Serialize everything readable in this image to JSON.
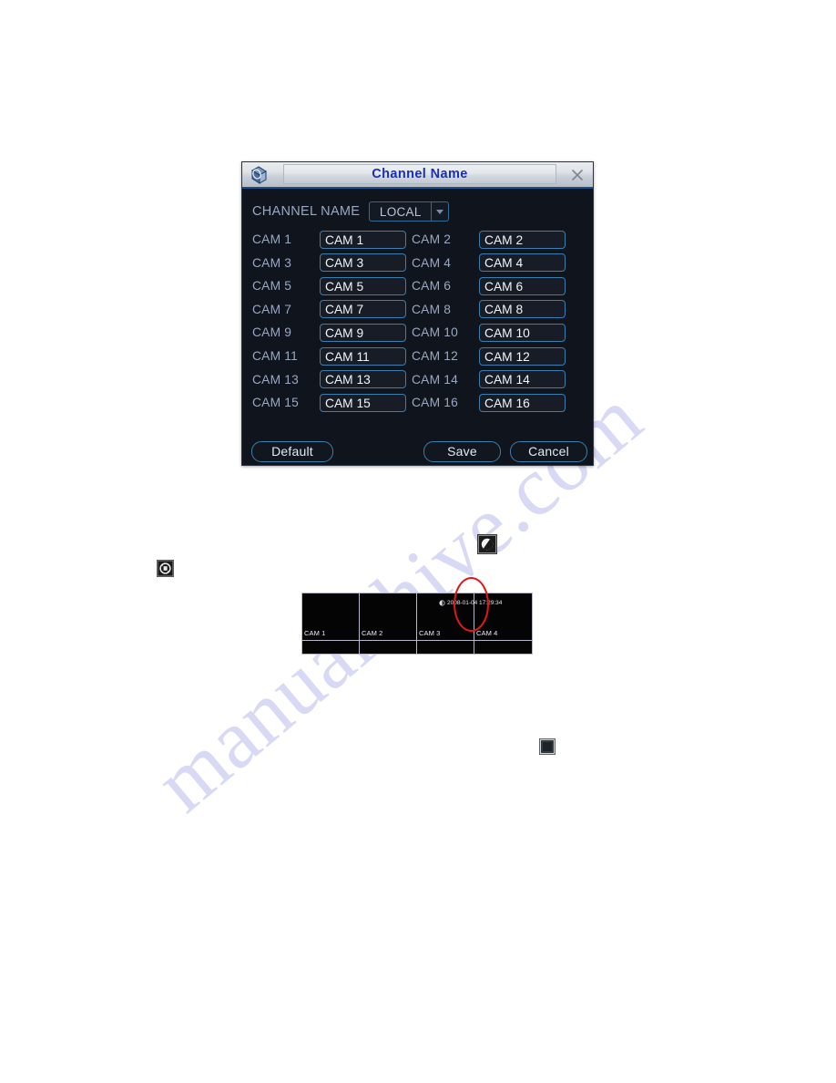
{
  "page": {
    "background_color": "#ffffff",
    "watermark": {
      "text": "manualshive.com",
      "color": "#d8d9f4"
    }
  },
  "dialog": {
    "title": "Channel Name",
    "title_color": "#1c2fae",
    "logo_icon": "cube-logo-icon",
    "close_icon": "close-icon",
    "background_color": "#10141c",
    "accent_color": "#3a7fae",
    "source": {
      "label": "CHANNEL NAME",
      "selected": "LOCAL",
      "options": [
        "LOCAL"
      ],
      "arrow_icon": "chevron-down-icon"
    },
    "channels": [
      {
        "label": "CAM 1",
        "value": "CAM 1"
      },
      {
        "label": "CAM 2",
        "value": "CAM 2"
      },
      {
        "label": "CAM 3",
        "value": "CAM 3"
      },
      {
        "label": "CAM 4",
        "value": "CAM 4"
      },
      {
        "label": "CAM 5",
        "value": "CAM 5"
      },
      {
        "label": "CAM 6",
        "value": "CAM 6"
      },
      {
        "label": "CAM 7",
        "value": "CAM 7"
      },
      {
        "label": "CAM 8",
        "value": "CAM 8"
      },
      {
        "label": "CAM 9",
        "value": "CAM 9"
      },
      {
        "label": "CAM 10",
        "value": "CAM 10"
      },
      {
        "label": "CAM 11",
        "value": "CAM 11"
      },
      {
        "label": "CAM 12",
        "value": "CAM 12"
      },
      {
        "label": "CAM 13",
        "value": "CAM 13"
      },
      {
        "label": "CAM 14",
        "value": "CAM 14"
      },
      {
        "label": "CAM 15",
        "value": "CAM 15"
      },
      {
        "label": "CAM 16",
        "value": "CAM 16"
      }
    ],
    "buttons": {
      "default": "Default",
      "save": "Save",
      "cancel": "Cancel"
    }
  },
  "standalone_icons": [
    {
      "name": "rotate-icon-large",
      "glyph": "rotate"
    },
    {
      "name": "rotate-icon-small",
      "glyph": "rotate"
    },
    {
      "name": "window-icon",
      "glyph": "square"
    }
  ],
  "video_preview": {
    "timestamp": "2008-01-04 17:29:34",
    "timestamp_icon": "record-clock-icon",
    "cells": [
      {
        "label": "CAM 1"
      },
      {
        "label": "CAM 2"
      },
      {
        "label": "CAM 3"
      },
      {
        "label": "CAM 4"
      }
    ],
    "annotation": {
      "name": "red-ellipse-annotation",
      "color": "#e01818"
    }
  }
}
